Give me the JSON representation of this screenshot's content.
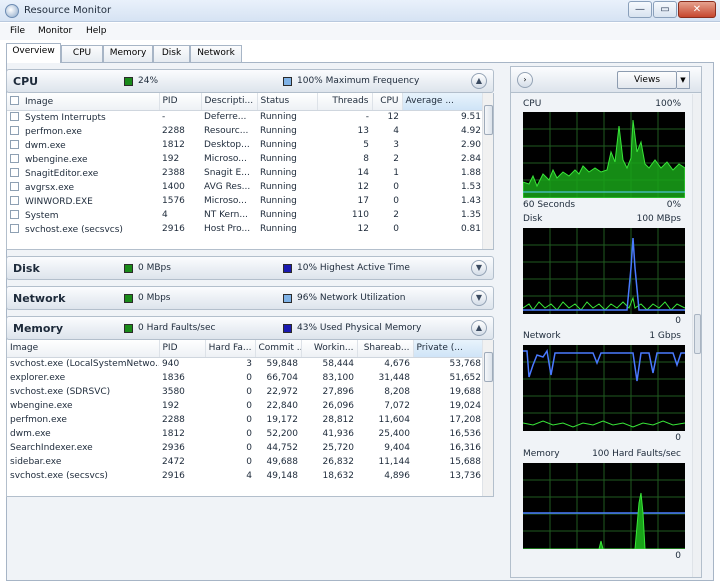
{
  "window": {
    "title": "Resource Monitor",
    "minimize": "—",
    "maximize": "▭",
    "close": "✕"
  },
  "menu": [
    "File",
    "Monitor",
    "Help"
  ],
  "tabs": [
    "Overview",
    "CPU",
    "Memory",
    "Disk",
    "Network"
  ],
  "cpu": {
    "title": "CPU",
    "stat1": "24%",
    "stat2": "100% Maximum Frequency",
    "stat1_color": "#1a8a1a",
    "stat2_color": "#7fb2e6",
    "columns": [
      "Image",
      "PID",
      "Descripti...",
      "Status",
      "Threads",
      "CPU",
      "Average ..."
    ],
    "rows": [
      [
        "System Interrupts",
        "-",
        "Deferre...",
        "Running",
        "-",
        "12",
        "9.51"
      ],
      [
        "perfmon.exe",
        "2288",
        "Resourc...",
        "Running",
        "13",
        "4",
        "4.92"
      ],
      [
        "dwm.exe",
        "1812",
        "Desktop...",
        "Running",
        "5",
        "3",
        "2.90"
      ],
      [
        "wbengine.exe",
        "192",
        "Microso...",
        "Running",
        "8",
        "2",
        "2.84"
      ],
      [
        "SnagitEditor.exe",
        "2388",
        "Snagit E...",
        "Running",
        "14",
        "1",
        "1.88"
      ],
      [
        "avgrsx.exe",
        "1400",
        "AVG Res...",
        "Running",
        "12",
        "0",
        "1.53"
      ],
      [
        "WINWORD.EXE",
        "1576",
        "Microso...",
        "Running",
        "17",
        "0",
        "1.43"
      ],
      [
        "System",
        "4",
        "NT Kern...",
        "Running",
        "110",
        "2",
        "1.35"
      ],
      [
        "svchost.exe (secsvcs)",
        "2916",
        "Host Pro...",
        "Running",
        "12",
        "0",
        "0.81"
      ]
    ]
  },
  "disk": {
    "title": "Disk",
    "stat1": "0 MBps",
    "stat2": "10% Highest Active Time",
    "stat1_color": "#1a8a1a",
    "stat2_color": "#1a1ab0"
  },
  "network": {
    "title": "Network",
    "stat1": "0 Mbps",
    "stat2": "96% Network Utilization",
    "stat1_color": "#1a8a1a",
    "stat2_color": "#7fb2e6"
  },
  "memory": {
    "title": "Memory",
    "stat1": "0 Hard Faults/sec",
    "stat2": "43% Used Physical Memory",
    "stat1_color": "#1a8a1a",
    "stat2_color": "#1a1ab0",
    "columns": [
      "Image",
      "PID",
      "Hard Fa...",
      "Commit ...",
      "Workin...",
      "Shareab...",
      "Private (..."
    ],
    "rows": [
      [
        "svchost.exe (LocalSystemNetwo...",
        "940",
        "3",
        "59,848",
        "58,444",
        "4,676",
        "53,768"
      ],
      [
        "explorer.exe",
        "1836",
        "0",
        "66,704",
        "83,100",
        "31,448",
        "51,652"
      ],
      [
        "svchost.exe (SDRSVC)",
        "3580",
        "0",
        "22,972",
        "27,896",
        "8,208",
        "19,688"
      ],
      [
        "wbengine.exe",
        "192",
        "0",
        "22,840",
        "26,096",
        "7,072",
        "19,024"
      ],
      [
        "perfmon.exe",
        "2288",
        "0",
        "19,172",
        "28,812",
        "11,604",
        "17,208"
      ],
      [
        "dwm.exe",
        "1812",
        "0",
        "52,200",
        "41,936",
        "25,400",
        "16,536"
      ],
      [
        "SearchIndexer.exe",
        "2936",
        "0",
        "44,752",
        "25,720",
        "9,404",
        "16,316"
      ],
      [
        "sidebar.exe",
        "2472",
        "0",
        "49,688",
        "26,832",
        "11,144",
        "15,688"
      ],
      [
        "svchost.exe (secsvcs)",
        "2916",
        "4",
        "49,148",
        "18,632",
        "4,896",
        "13,736"
      ]
    ]
  },
  "right_panel": {
    "views_label": "Views",
    "expand_icon": "›",
    "dropdown_icon": "▼",
    "graphs": [
      {
        "name": "CPU",
        "max": "100%",
        "bottom_left": "60 Seconds",
        "bottom_right": "0%"
      },
      {
        "name": "Disk",
        "max": "100 MBps",
        "bottom_left": "",
        "bottom_right": "0"
      },
      {
        "name": "Network",
        "max": "1 Gbps",
        "bottom_left": "",
        "bottom_right": "0"
      },
      {
        "name": "Memory",
        "max": "100 Hard Faults/sec",
        "bottom_left": "",
        "bottom_right": "0"
      }
    ]
  },
  "icons": {
    "collapse": "chevron-up-icon",
    "expand": "chevron-down-icon"
  }
}
